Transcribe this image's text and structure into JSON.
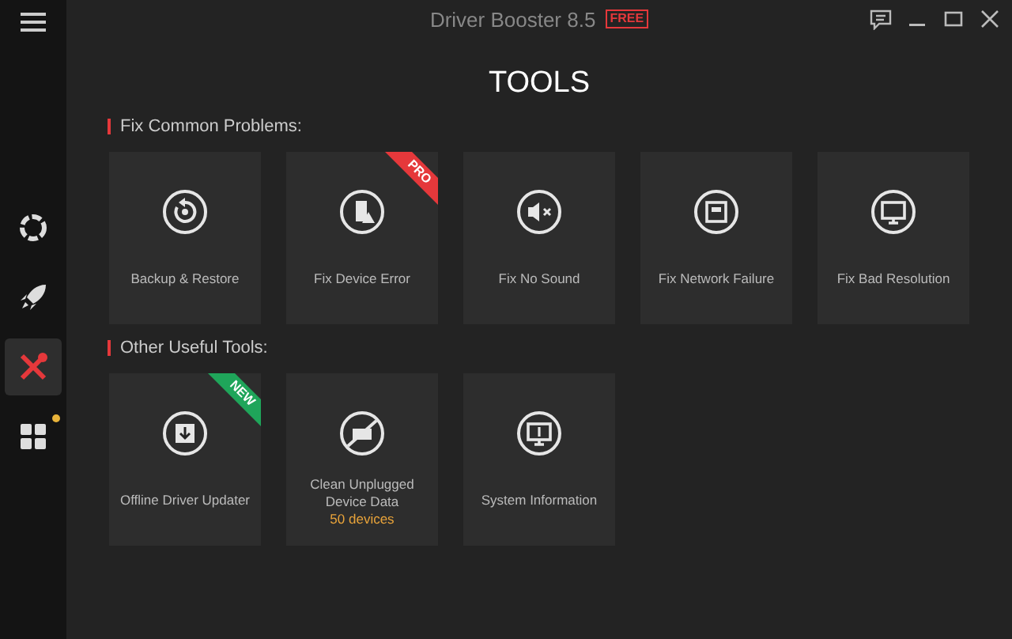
{
  "window": {
    "title": "Driver Booster 8.5",
    "edition_badge": "FREE"
  },
  "sidebar": {
    "items": [
      {
        "selected": false,
        "notification": false
      },
      {
        "selected": false,
        "notification": false
      },
      {
        "selected": true,
        "notification": false
      },
      {
        "selected": false,
        "notification": true
      }
    ]
  },
  "page_title": "TOOLS",
  "sections": [
    {
      "title": "Fix Common Problems:",
      "tools": [
        {
          "label": "Backup & Restore"
        },
        {
          "label": "Fix Device Error",
          "badge": {
            "label": "PRO",
            "color": "#e5383b"
          }
        },
        {
          "label": "Fix No Sound"
        },
        {
          "label": "Fix Network Failure"
        },
        {
          "label": "Fix Bad Resolution"
        }
      ]
    },
    {
      "title": "Other Useful Tools:",
      "tools": [
        {
          "label": "Offline Driver Updater",
          "badge": {
            "label": "NEW",
            "color": "#1fa55a"
          }
        },
        {
          "label": "Clean Unplugged Device Data",
          "detail": "50 devices"
        },
        {
          "label": "System Information"
        }
      ]
    }
  ]
}
